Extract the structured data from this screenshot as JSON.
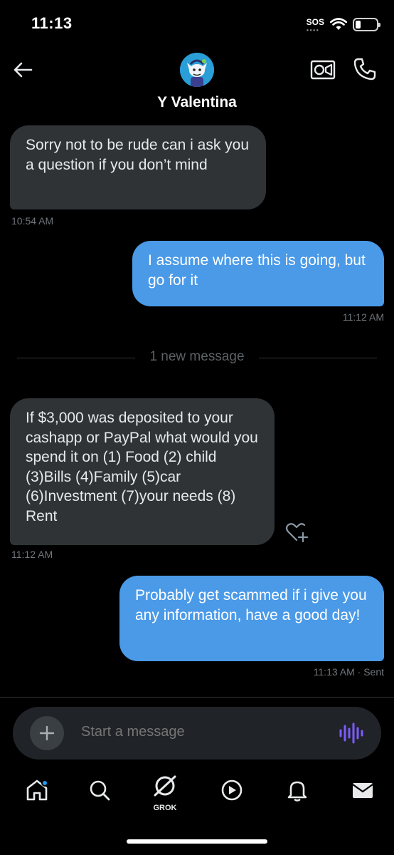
{
  "status_bar": {
    "time": "11:13",
    "sos": "SOS",
    "battery_level": 0.25
  },
  "header": {
    "back_icon": "arrow-left-icon",
    "contact_name": "Y Valentina",
    "video_icon": "video-camera-icon",
    "call_icon": "phone-icon"
  },
  "messages": [
    {
      "direction": "in",
      "text": "Sorry not to be rude can i ask you a question if you don’t mind",
      "time": "10:54 AM"
    },
    {
      "direction": "out",
      "text": "I assume where this is going, but go for it",
      "time": "11:12 AM"
    },
    {
      "direction": "in",
      "text": "If $3,000 was deposited to your cashapp or PayPal what would you spend it on  (1) Food  (2) child (3)Bills (4)Family (5)car (6)Investment (7)your needs (8) Rent",
      "time": "11:12 AM"
    },
    {
      "direction": "out",
      "text": "Probably get scammed if i give you any information, have a good day!",
      "time": "11:13 AM · Sent"
    }
  ],
  "divider": {
    "label": "1 new message"
  },
  "composer": {
    "placeholder": "Start a message",
    "add_icon": "plus-icon",
    "voice_icon": "voice-waveform-icon"
  },
  "nav": {
    "grok_label": "GROK",
    "items": [
      "home-icon",
      "search-icon",
      "grok-icon",
      "play-icon",
      "bell-icon",
      "mail-icon"
    ]
  },
  "colors": {
    "bubble_in": "#2f3336",
    "bubble_out": "#4a9ae8",
    "accent": "#1d9bf0",
    "voice": "#7b5cff"
  }
}
